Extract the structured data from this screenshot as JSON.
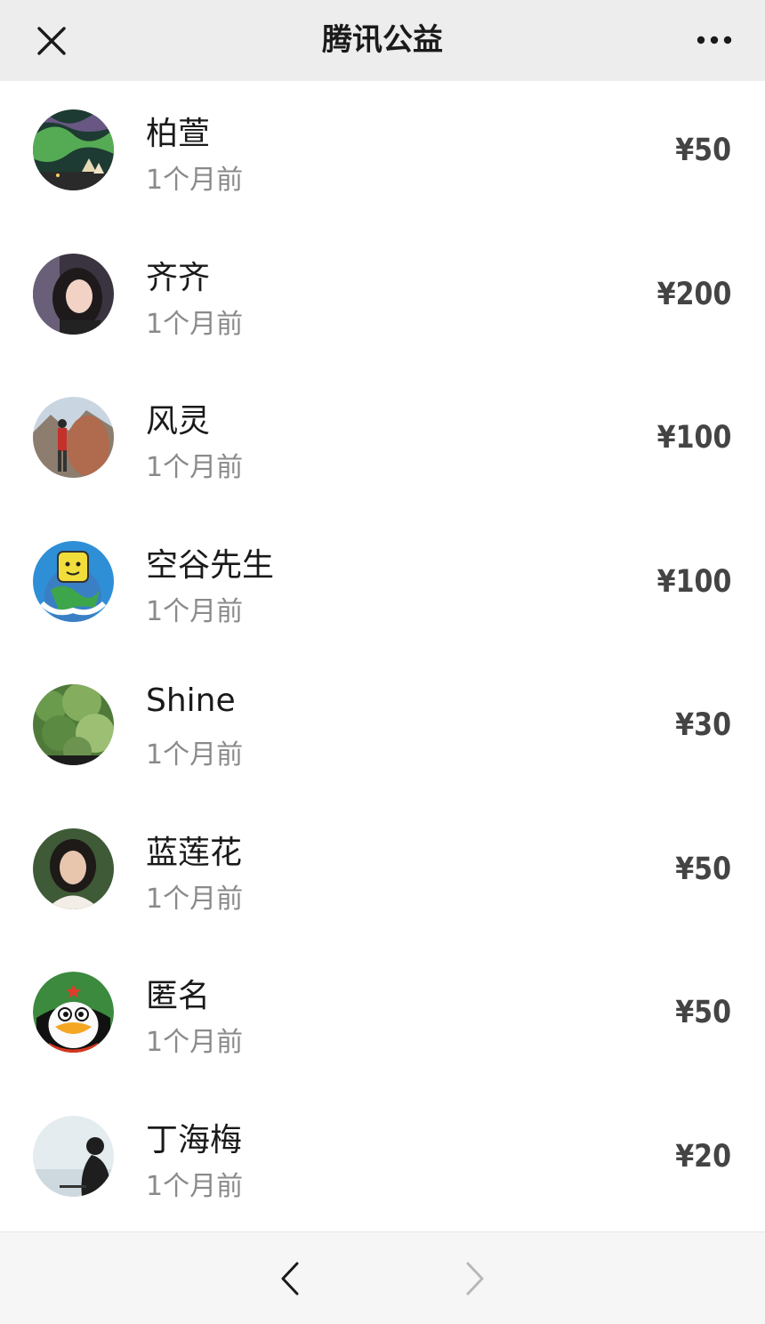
{
  "header": {
    "title": "腾讯公益",
    "close_icon": "close-icon",
    "more_icon": "more-icon"
  },
  "donors": [
    {
      "name": "柏萱",
      "time": "1个月前",
      "amount": "¥50",
      "avatar": "aurora-photo"
    },
    {
      "name": "齐齐",
      "time": "1个月前",
      "amount": "¥200",
      "avatar": "woman-portrait"
    },
    {
      "name": "风灵",
      "time": "1个月前",
      "amount": "¥100",
      "avatar": "travel-rock-photo"
    },
    {
      "name": "空谷先生",
      "time": "1个月前",
      "amount": "¥100",
      "avatar": "cartoon-earth-hug"
    },
    {
      "name": "Shine",
      "time": "1个月前",
      "amount": "¥30",
      "avatar": "green-shrubs-photo"
    },
    {
      "name": "蓝莲花",
      "time": "1个月前",
      "amount": "¥50",
      "avatar": "woman-portrait"
    },
    {
      "name": "匿名",
      "time": "1个月前",
      "amount": "¥50",
      "avatar": "qq-penguin-soldier"
    },
    {
      "name": "丁海梅",
      "time": "1个月前",
      "amount": "¥20",
      "avatar": "silhouette-photo"
    }
  ],
  "footer": {
    "back_icon": "chevron-left-icon",
    "forward_icon": "chevron-right-icon"
  },
  "colors": {
    "header_bg": "#ededed",
    "footer_bg": "#f6f6f6",
    "amount": "#444444",
    "time": "#8a8a8a"
  }
}
